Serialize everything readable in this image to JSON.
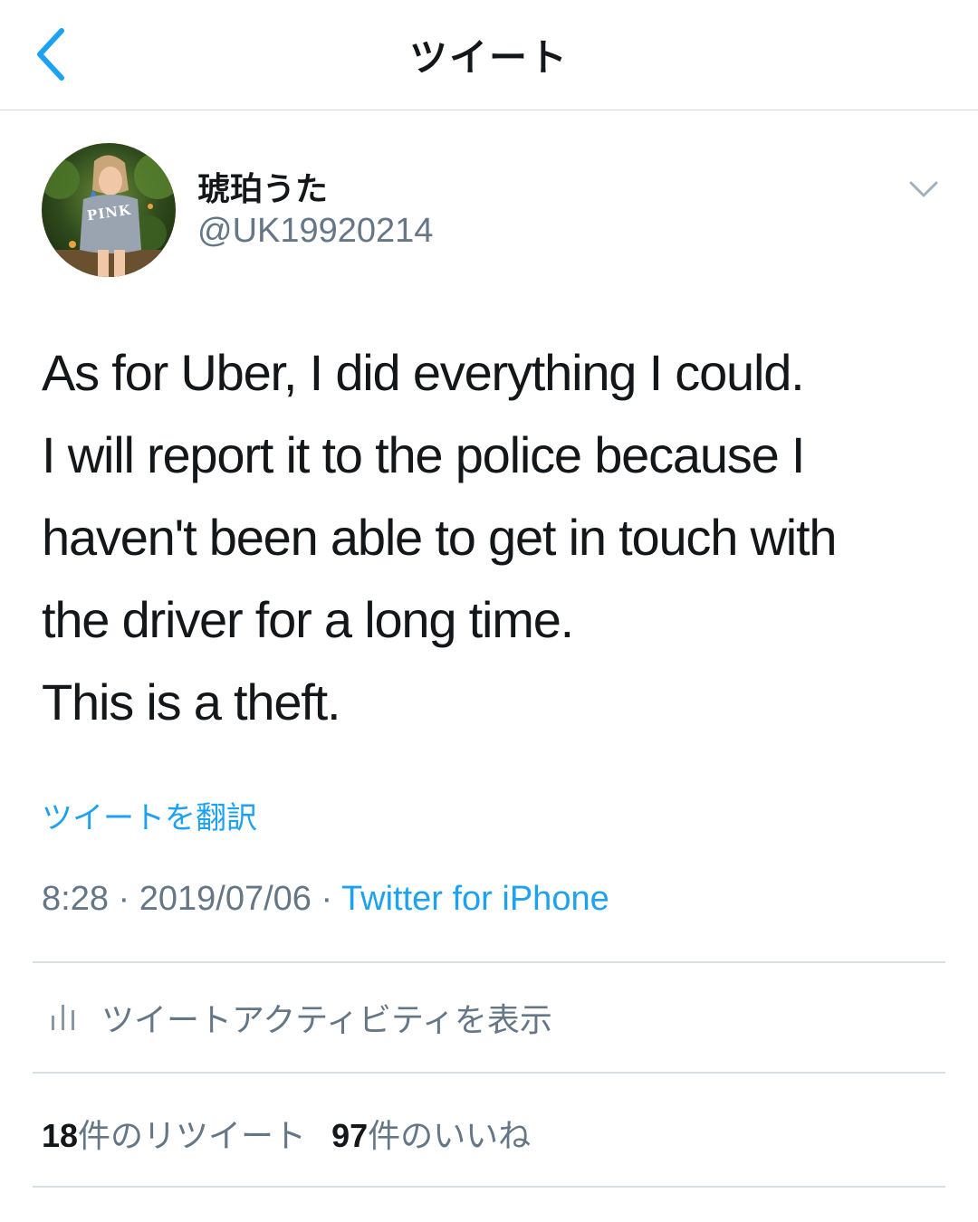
{
  "header": {
    "title": "ツイート",
    "back_icon": "chevron-left-icon"
  },
  "author": {
    "display_name": "琥珀うた",
    "handle": "@UK19920214",
    "avatar_shirt_text": "PINK"
  },
  "tweet": {
    "text": "As for Uber, I did everything I could.\nI will report it to the police because I\nhaven't been able to get in touch with\nthe driver for a long time.\nThis is a theft.",
    "translate_label": "ツイートを翻訳",
    "time": "8:28",
    "separator": " · ",
    "date": "2019/07/06",
    "source": "Twitter for iPhone"
  },
  "activity": {
    "icon": "bar-chart-icon",
    "label": "ツイートアクティビティを表示"
  },
  "stats": {
    "retweets_count": "18",
    "retweets_label": "件のリツイート",
    "likes_count": "97",
    "likes_label": "件のいいね"
  },
  "colors": {
    "accent": "#1da1f2",
    "secondary_text": "#657786",
    "divider": "#d8e0e6"
  }
}
